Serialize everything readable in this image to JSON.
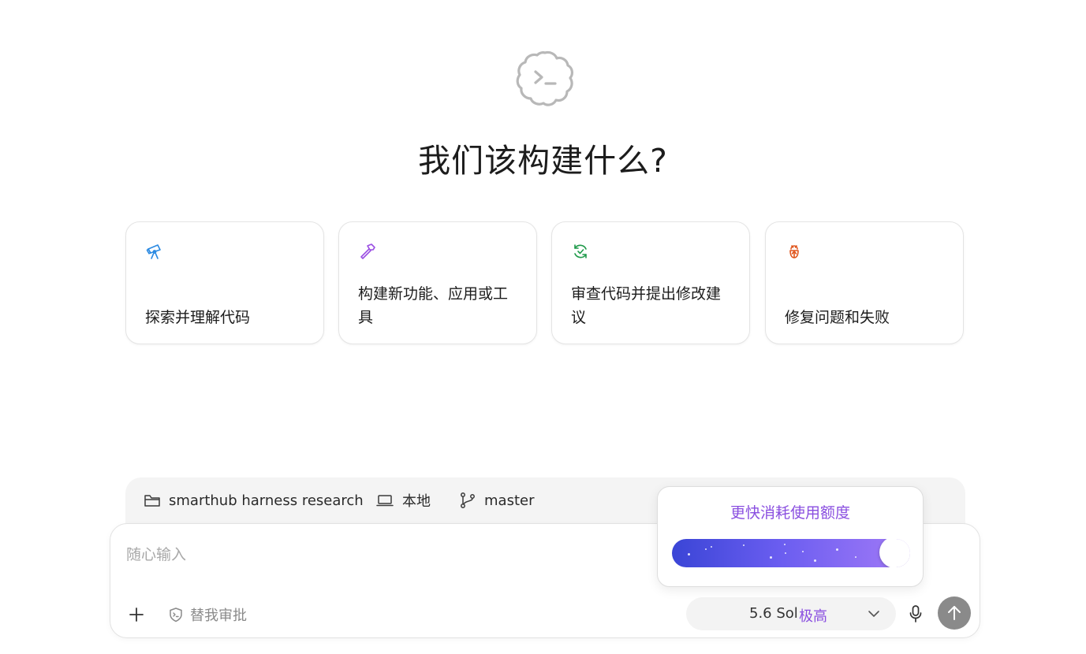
{
  "hero": {
    "title": "我们该构建什么?"
  },
  "cards": [
    {
      "label": "探索并理解代码",
      "icon": "telescope-icon",
      "color": "#2b8ae2"
    },
    {
      "label": "构建新功能、应用或工具",
      "icon": "hammer-icon",
      "color": "#9b4fe3"
    },
    {
      "label": "审查代码并提出修改建议",
      "icon": "refresh-check-icon",
      "color": "#1f9a4a"
    },
    {
      "label": "修复问题和失败",
      "icon": "bug-icon",
      "color": "#e0541b"
    }
  ],
  "context": {
    "project": "smarthub harness research",
    "environment": "本地",
    "branch": "master"
  },
  "composer": {
    "placeholder": "随心输入",
    "approve_label": "替我审批",
    "model_name": "5.6 Sol",
    "model_effort": "极高"
  },
  "popover": {
    "title": "更快消耗使用额度",
    "toggle_on": true
  },
  "colors": {
    "accent_purple": "#8a4fe0",
    "send_button": "#8a8a8a"
  }
}
